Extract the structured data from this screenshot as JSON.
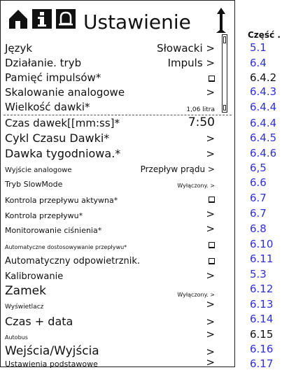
{
  "header": {
    "title": "Ustawienie",
    "icons": [
      "home-icon",
      "info-icon",
      "alarm-bell-icon",
      "up-arrow-icon"
    ]
  },
  "section_header": "Część .",
  "rows": [
    {
      "label": "Język",
      "value": "Słowacki >",
      "value_type": "text",
      "section": "5.1",
      "section_link": true
    },
    {
      "label": "Działanie. tryb",
      "value": "Impuls >",
      "value_type": "text",
      "section": "6.4",
      "section_link": true
    },
    {
      "label": "Pamięć impulsów*",
      "value": "",
      "value_type": "checkbox",
      "section": "6.4.2",
      "section_link": false
    },
    {
      "label": "Skalowanie analogowe",
      "value": ">",
      "value_type": "text",
      "section": "6.4.3",
      "section_link": true
    },
    {
      "label": "Wielkość dawki*",
      "value": "1,06 litra",
      "value_type": "text",
      "section": "6.4.4",
      "section_link": true
    },
    {
      "label": "Czas dawek[[mm:ss]*",
      "value": "7:50",
      "value_type": "text",
      "section": "6.4.4",
      "section_link": true
    },
    {
      "label": "Cykl Czasu Dawki*",
      "value": ">",
      "value_type": "text",
      "section": "6.4.5",
      "section_link": true
    },
    {
      "label": "Dawka tygodniowa.*",
      "value": ">",
      "value_type": "text",
      "section": "6.4.6",
      "section_link": true
    },
    {
      "label": "Wyjście analogowe",
      "value": "Przepływ prądu >",
      "value_type": "text",
      "section": "6,5",
      "section_link": true
    },
    {
      "label": "Tryb SlowMode",
      "value": "Wyłączony. >",
      "value_type": "text",
      "section": "6.6",
      "section_link": true
    },
    {
      "label": "Kontrola przepływu aktywna*",
      "value": "",
      "value_type": "checkbox",
      "section": "6.7",
      "section_link": true
    },
    {
      "label": "Kontrola przepływu*",
      "value": ">",
      "value_type": "text",
      "section": "6.7",
      "section_link": true
    },
    {
      "label": "Monitorowanie ciśnienia*",
      "value": ">",
      "value_type": "text",
      "section": "6.8",
      "section_link": true
    },
    {
      "label": "Automatyczne dostosowywanie przepływu*",
      "value": "",
      "value_type": "checkbox",
      "section": "6.10",
      "section_link": true
    },
    {
      "label": "Automatyczny odpowietrznik.",
      "value": "",
      "value_type": "checkbox",
      "section": "6.11",
      "section_link": true
    },
    {
      "label": "Kalibrowanie",
      "value": ">",
      "value_type": "text",
      "section": "5.3",
      "section_link": true
    },
    {
      "label": "Zamek",
      "value": "Wyłączony. >",
      "value_type": "text",
      "section": "6.12",
      "section_link": true
    },
    {
      "label": "Wyświetlacz",
      "value": ">",
      "value_type": "text",
      "section": "6.13",
      "section_link": true
    },
    {
      "label": "Czas + data",
      "value": ">",
      "value_type": "text",
      "section": "6.14",
      "section_link": true
    },
    {
      "label": "Autobus",
      "value": ">",
      "value_type": "text",
      "section": "6.15",
      "section_link": false
    },
    {
      "label": "Wejścia/Wyjścia",
      "value": ">",
      "value_type": "text",
      "section": "6.16",
      "section_link": true
    },
    {
      "label": "Ustawienia podstawowe",
      "value": ">",
      "value_type": "text",
      "section": "6.17",
      "section_link": true
    }
  ],
  "colors": {
    "link": "#2f2fdc",
    "text": "#111111",
    "border": "#222222"
  }
}
